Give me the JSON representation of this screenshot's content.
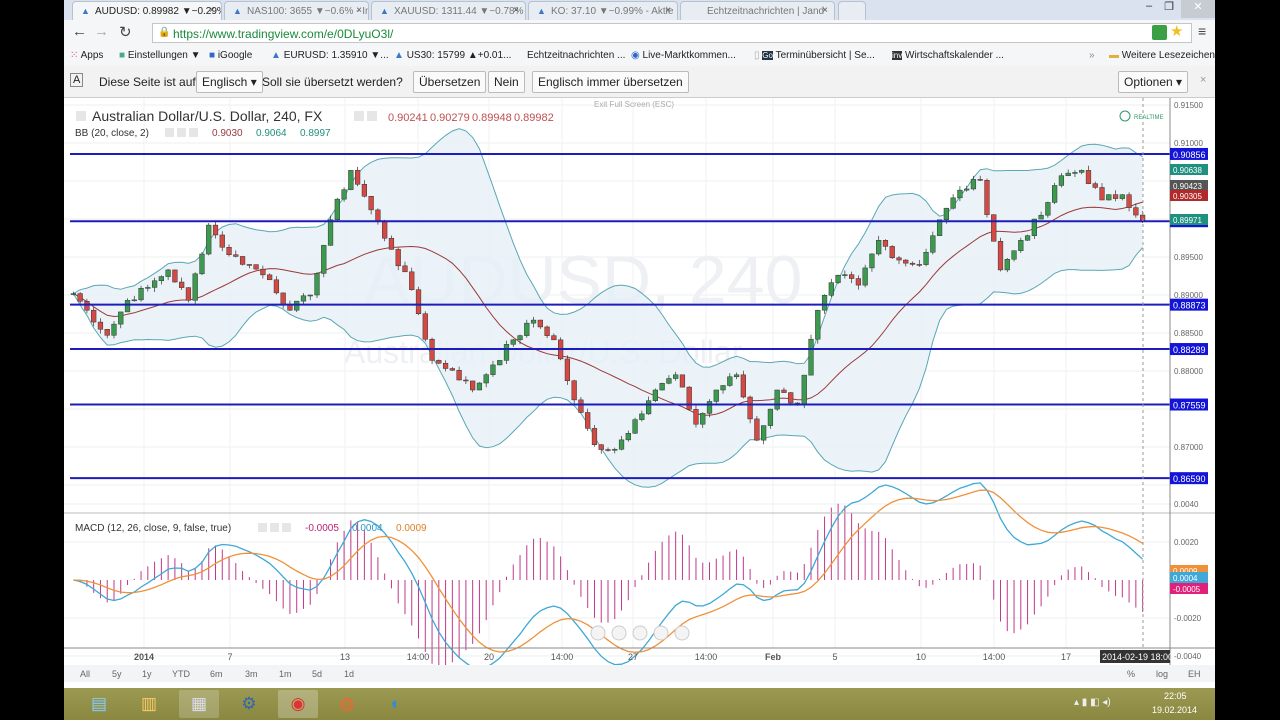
{
  "browser": {
    "tabs": [
      {
        "label": "AUDUSD: 0.89982 ▼−0.29%",
        "active": true
      },
      {
        "label": "NAS100: 3655 ▼−0.6% - In"
      },
      {
        "label": "XAUUSD: 1311.44 ▼−0.78%"
      },
      {
        "label": "KO: 37.10 ▼−0.99% - Aktie"
      },
      {
        "label": "Echtzeitnachrichten | Jand"
      }
    ],
    "url": "https://www.tradingview.com/e/0DLyuO3l/",
    "bookmarks": [
      "Apps",
      "Einstellungen ▼",
      "iGoogle",
      "EURUSD: 1.35910 ▼...",
      "US30: 15799 ▲+0.01...",
      "Echtzeitnachrichten ...",
      "Live-Marktkommen...",
      "Terminübersicht | Se...",
      "Wirtschaftskalender ...",
      "»",
      "Weitere Lesezeichen"
    ],
    "translate": {
      "prefix": "Diese Seite ist auf",
      "language": "Englisch",
      "question": "Soll sie übersetzt werden?",
      "translate": "Übersetzen",
      "no": "Nein",
      "always": "Englisch immer übersetzen",
      "options": "Optionen"
    }
  },
  "chart": {
    "exit_fullscreen": "Exit Full Screen (ESC)",
    "realtime": "REALTIME",
    "watermark_symbol": "AUDUSD, 240",
    "watermark_name": "Australian Dollar/U.S. Dollar",
    "title": "Australian Dollar/U.S. Dollar, 240, FX",
    "ohlc": [
      "0.90241",
      "0.90279",
      "0.89948",
      "0.89982"
    ],
    "bb_label": "BB (20, close, 2)",
    "bb_values": [
      "0.9030",
      "0.9064",
      "0.8997"
    ],
    "macd_label": "MACD (12, 26, close, 9, false, true)",
    "macd_values": [
      "-0.0005",
      "0.0004",
      "0.0009"
    ],
    "crosshair_time": "2014-02-19 18:00",
    "ranges": [
      "All",
      "5y",
      "1y",
      "YTD",
      "6m",
      "3m",
      "1m",
      "5d",
      "1d"
    ],
    "right_controls": [
      "%",
      "log",
      "EH"
    ],
    "colors": {
      "up": "#3c9a4f",
      "down": "#d24a43",
      "bb_band": "#5aa7b4",
      "bb_basis": "#9b3a3a",
      "hline": "#1d1dbb",
      "macd": "#3ea8d8",
      "signal": "#f0913a",
      "hist": "#c0388a"
    }
  },
  "chart_data": {
    "type": "candlestick",
    "price_axis_ticks": [
      "0.91500",
      "0.91000",
      "0.89500",
      "0.89000",
      "0.88500",
      "0.88000",
      "0.87000"
    ],
    "price_badges": [
      {
        "value": "0.90638",
        "color": "#1f8f7f"
      },
      {
        "value": "0.90423",
        "color": "#555555"
      },
      {
        "value": "0.90305",
        "color": "#b02a2a"
      },
      {
        "value": "0.89971",
        "color": "#1f8f7f"
      }
    ],
    "horizontal_lines": [
      "0.90856",
      "0.89971",
      "0.88873",
      "0.88289",
      "0.87559",
      "0.86590"
    ],
    "time_ticks": [
      "2014",
      "7",
      "13",
      "14:00",
      "20",
      "14:00",
      "27",
      "14:00",
      "Feb",
      "5",
      "10",
      "14:00",
      "17"
    ],
    "closes": [
      0.8913,
      0.888,
      0.8847,
      0.8893,
      0.891,
      0.8933,
      0.8893,
      0.8992,
      0.8953,
      0.894,
      0.892,
      0.888,
      0.89,
      0.8999,
      0.9064,
      0.9012,
      0.896,
      0.8907,
      0.8814,
      0.8801,
      0.8775,
      0.8808,
      0.8841,
      0.8867,
      0.8841,
      0.8762,
      0.8703,
      0.8697,
      0.8736,
      0.8775,
      0.8795,
      0.873,
      0.8775,
      0.8795,
      0.8709,
      0.8775,
      0.8756,
      0.888,
      0.8926,
      0.8913,
      0.8972,
      0.8946,
      0.894,
      0.8999,
      0.9038,
      0.9051,
      0.8933,
      0.8972,
      0.9005,
      0.9057,
      0.9064,
      0.9025,
      0.9032,
      0.8998
    ],
    "macd_axis_ticks": [
      "0.0040",
      "0.0020",
      "-0.0020",
      "-0.0040"
    ],
    "macd_badges": [
      {
        "value": "0.0009",
        "color": "#f0913a"
      },
      {
        "value": "0.0004",
        "color": "#3ea8d8"
      },
      {
        "value": "-0.0005",
        "color": "#e0207a"
      }
    ]
  },
  "taskbar": {
    "time": "22:05",
    "date": "19.02.2014"
  }
}
